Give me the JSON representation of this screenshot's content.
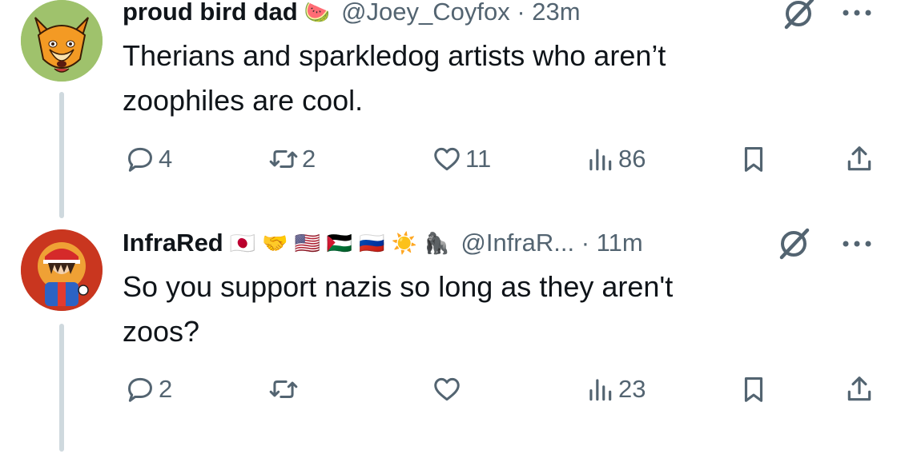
{
  "tweets": [
    {
      "display_name": "proud bird dad",
      "name_emojis": [
        "🍉"
      ],
      "handle_meta": "@Joey_Coyfox · 23m",
      "text": "Therians and sparkledog artists who aren’t\nzoophiles are cool.",
      "avatar_icon": "orange-fox-avatar",
      "actions": {
        "replies": "4",
        "reposts": "2",
        "likes": "11",
        "views": "86"
      }
    },
    {
      "display_name": "InfraRed",
      "name_emojis": [
        "🇯🇵",
        "🤝",
        "🇺🇸",
        "🇵🇸",
        "🇷🇺",
        "☀️",
        "🦍"
      ],
      "handle_meta": "@InfraR... · 11m",
      "text": "So you support nazis so long as they aren't\nzoos?",
      "avatar_icon": "trainer-red-avatar",
      "actions": {
        "replies": "2",
        "reposts": "",
        "likes": "",
        "views": "23"
      }
    }
  ],
  "colors": {
    "text": "#0f1419",
    "secondary": "#536471",
    "thread_line": "#cfd9de",
    "background": "#ffffff"
  }
}
